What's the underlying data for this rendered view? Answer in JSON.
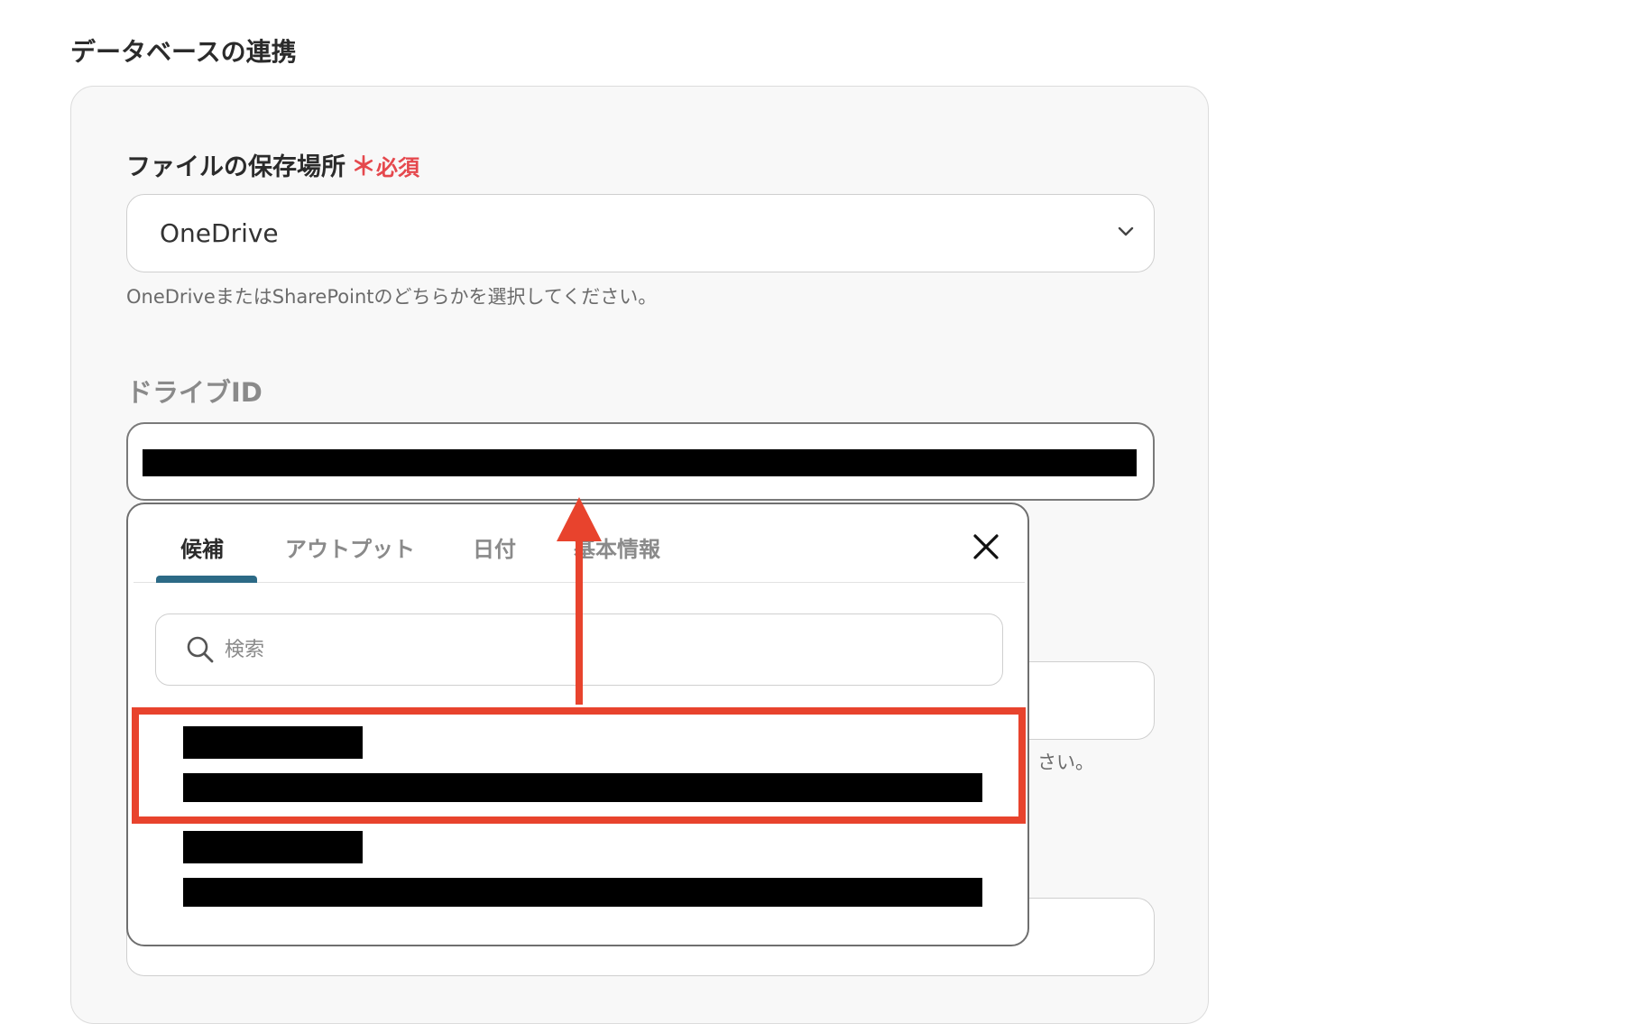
{
  "section": {
    "title": "データベースの連携"
  },
  "storage_field": {
    "label": "ファイルの保存場所",
    "required_mark": "＊",
    "required_text": "必須",
    "value": "OneDrive",
    "help": "OneDriveまたはSharePointのどちらかを選択してください。"
  },
  "drive_field": {
    "label": "ドライブID",
    "value": "[redacted]"
  },
  "behind_fragments": {
    "help_tail": "さい。"
  },
  "popup": {
    "tabs": [
      {
        "label": "候補",
        "active": true
      },
      {
        "label": "アウトプット",
        "active": false
      },
      {
        "label": "日付",
        "active": false
      },
      {
        "label": "基本情報",
        "active": false
      }
    ],
    "search_placeholder": "検索",
    "options": [
      {
        "title": "[redacted]",
        "id": "[redacted]",
        "highlighted": true
      },
      {
        "title": "[redacted]",
        "id": "[redacted]",
        "highlighted": false
      }
    ]
  },
  "annotation": {
    "color": "#e8432d"
  },
  "colors": {
    "accent_tab": "#2c6a86",
    "required": "#e5484d",
    "card_bg": "#f8f8f8"
  },
  "icons": [
    "chevron-down-icon",
    "close-icon",
    "search-icon"
  ]
}
